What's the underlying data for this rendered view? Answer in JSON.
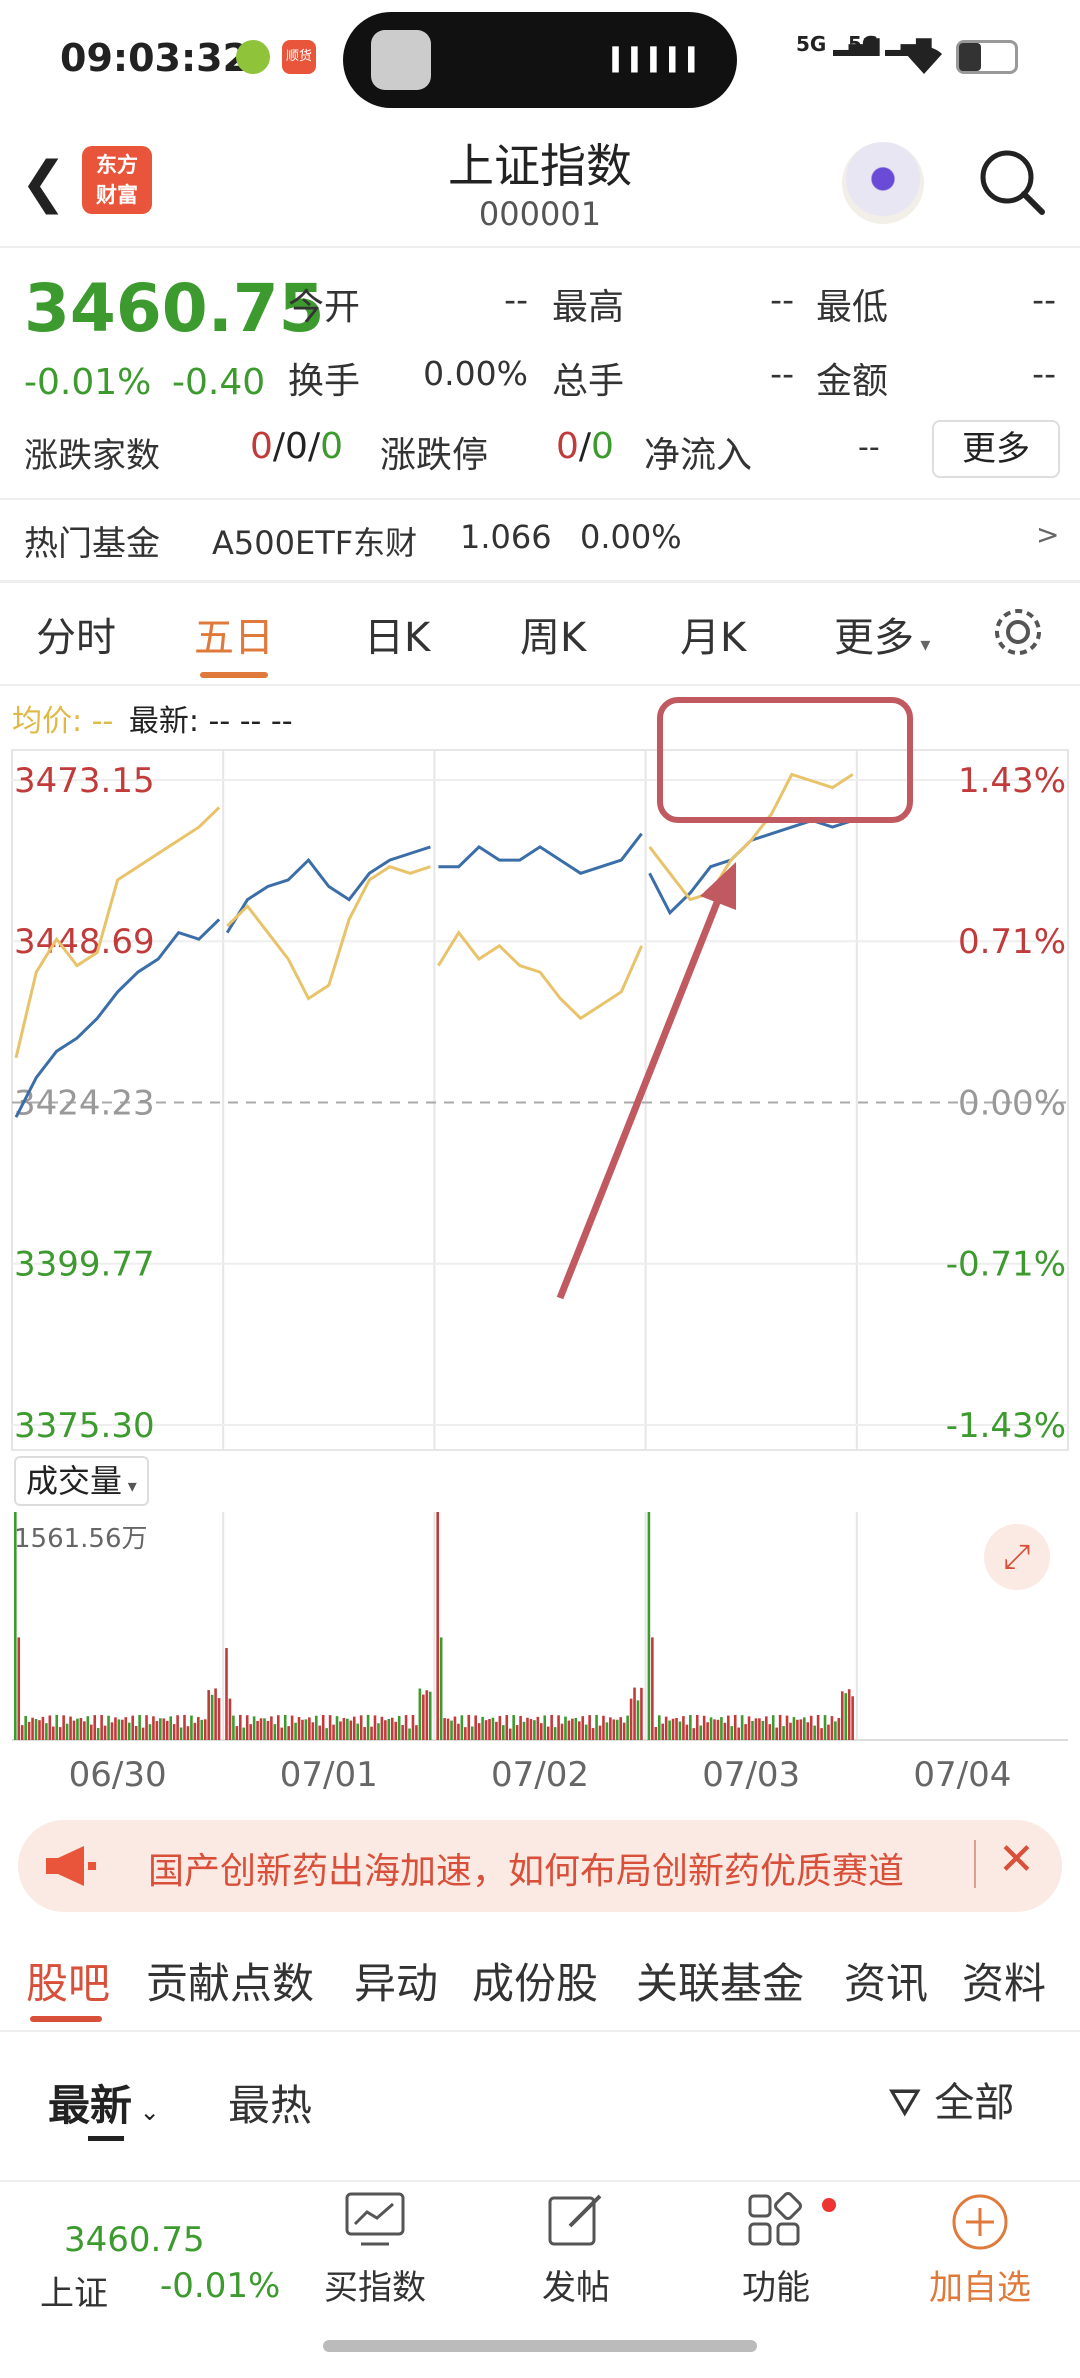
{
  "status": {
    "time": "09:03:32",
    "net1": "5G",
    "net2": "5G",
    "app_badge": "顺货"
  },
  "header": {
    "logo_line1": "东方",
    "logo_line2": "财富",
    "title": "上证指数",
    "code": "000001"
  },
  "quote": {
    "price": "3460.75",
    "change_pct": "-0.01%",
    "change": "-0.40",
    "stats": [
      {
        "label": "今开",
        "value": "--"
      },
      {
        "label": "最高",
        "value": "--"
      },
      {
        "label": "最低",
        "value": "--"
      },
      {
        "label": "换手",
        "value": "0.00%"
      },
      {
        "label": "总手",
        "value": "--"
      },
      {
        "label": "金额",
        "value": "--"
      }
    ],
    "advance_label": "涨跌家数",
    "adv_up": "0",
    "adv_flat": "0",
    "adv_down": "0",
    "limit_label": "涨跌停",
    "limit_up": "0",
    "limit_down": "0",
    "netflow_label": "净流入",
    "netflow_value": "--",
    "more": "更多"
  },
  "hot_fund": {
    "label": "热门基金",
    "name": "A500ETF东财",
    "price": "1.066",
    "pct": "0.00%",
    "arrow": ">"
  },
  "tabs": [
    "分时",
    "五日",
    "日K",
    "周K",
    "月K",
    "更多"
  ],
  "active_tab": 1,
  "chart_legend": {
    "avg_label": "均价:",
    "avg_value": "--",
    "latest_label": "最新:",
    "latest_value": "--  --  --"
  },
  "chart_data": {
    "type": "line",
    "y_left_ticks": [
      "3473.15",
      "3448.69",
      "3424.23",
      "3399.77",
      "3375.30"
    ],
    "y_right_ticks": [
      "1.43%",
      "0.71%",
      "0.00%",
      "-0.71%",
      "-1.43%"
    ],
    "ylim": [
      3375.3,
      3473.15
    ],
    "x_ticks": [
      "06/30",
      "07/01",
      "07/02",
      "07/03",
      "07/04"
    ],
    "series": [
      {
        "color": "#3b6ea8",
        "days": [
          [
            3422,
            3428,
            3432,
            3434,
            3437,
            3441,
            3444,
            3446,
            3450,
            3449,
            3452
          ],
          [
            3450,
            3455,
            3457,
            3458,
            3461,
            3457,
            3455,
            3459,
            3461,
            3462,
            3463
          ],
          [
            3460,
            3460,
            3463,
            3461,
            3461,
            3463,
            3461,
            3459,
            3460,
            3461,
            3465
          ],
          [
            3459,
            3453,
            3456,
            3460,
            3461,
            3464,
            3465,
            3466,
            3467,
            3466,
            3467
          ]
        ]
      },
      {
        "color": "#e8c36a",
        "days": [
          [
            3431,
            3444,
            3449,
            3445,
            3447,
            3458,
            3460,
            3462,
            3464,
            3466,
            3469
          ],
          [
            3451,
            3454,
            3450,
            3446,
            3440,
            3442,
            3452,
            3458,
            3460,
            3459,
            3460
          ],
          [
            3445,
            3450,
            3446,
            3448,
            3445,
            3444,
            3440,
            3437,
            3439,
            3441,
            3448
          ],
          [
            3463,
            3459,
            3455,
            3456,
            3461,
            3464,
            3468,
            3474,
            3473,
            3472,
            3474
          ]
        ]
      }
    ]
  },
  "volume": {
    "label": "成交量",
    "max_label": "1561.56万",
    "peaks": [
      1561.56,
      630,
      1561.56,
      1561.56,
      520
    ]
  },
  "news": {
    "text": "国产创新药出海加速，如何布局创新药优质赛道"
  },
  "bottom_tabs": [
    "股吧",
    "贡献点数",
    "异动",
    "成份股",
    "关联基金",
    "资讯",
    "资料"
  ],
  "sort": {
    "latest": "最新",
    "hot": "最热",
    "filter": "全部"
  },
  "nav": {
    "mini_price": "3460.75",
    "mini_name": "上证",
    "mini_pct": "-0.01%",
    "buy": "买指数",
    "post": "发帖",
    "func": "功能",
    "add": "加自选"
  }
}
